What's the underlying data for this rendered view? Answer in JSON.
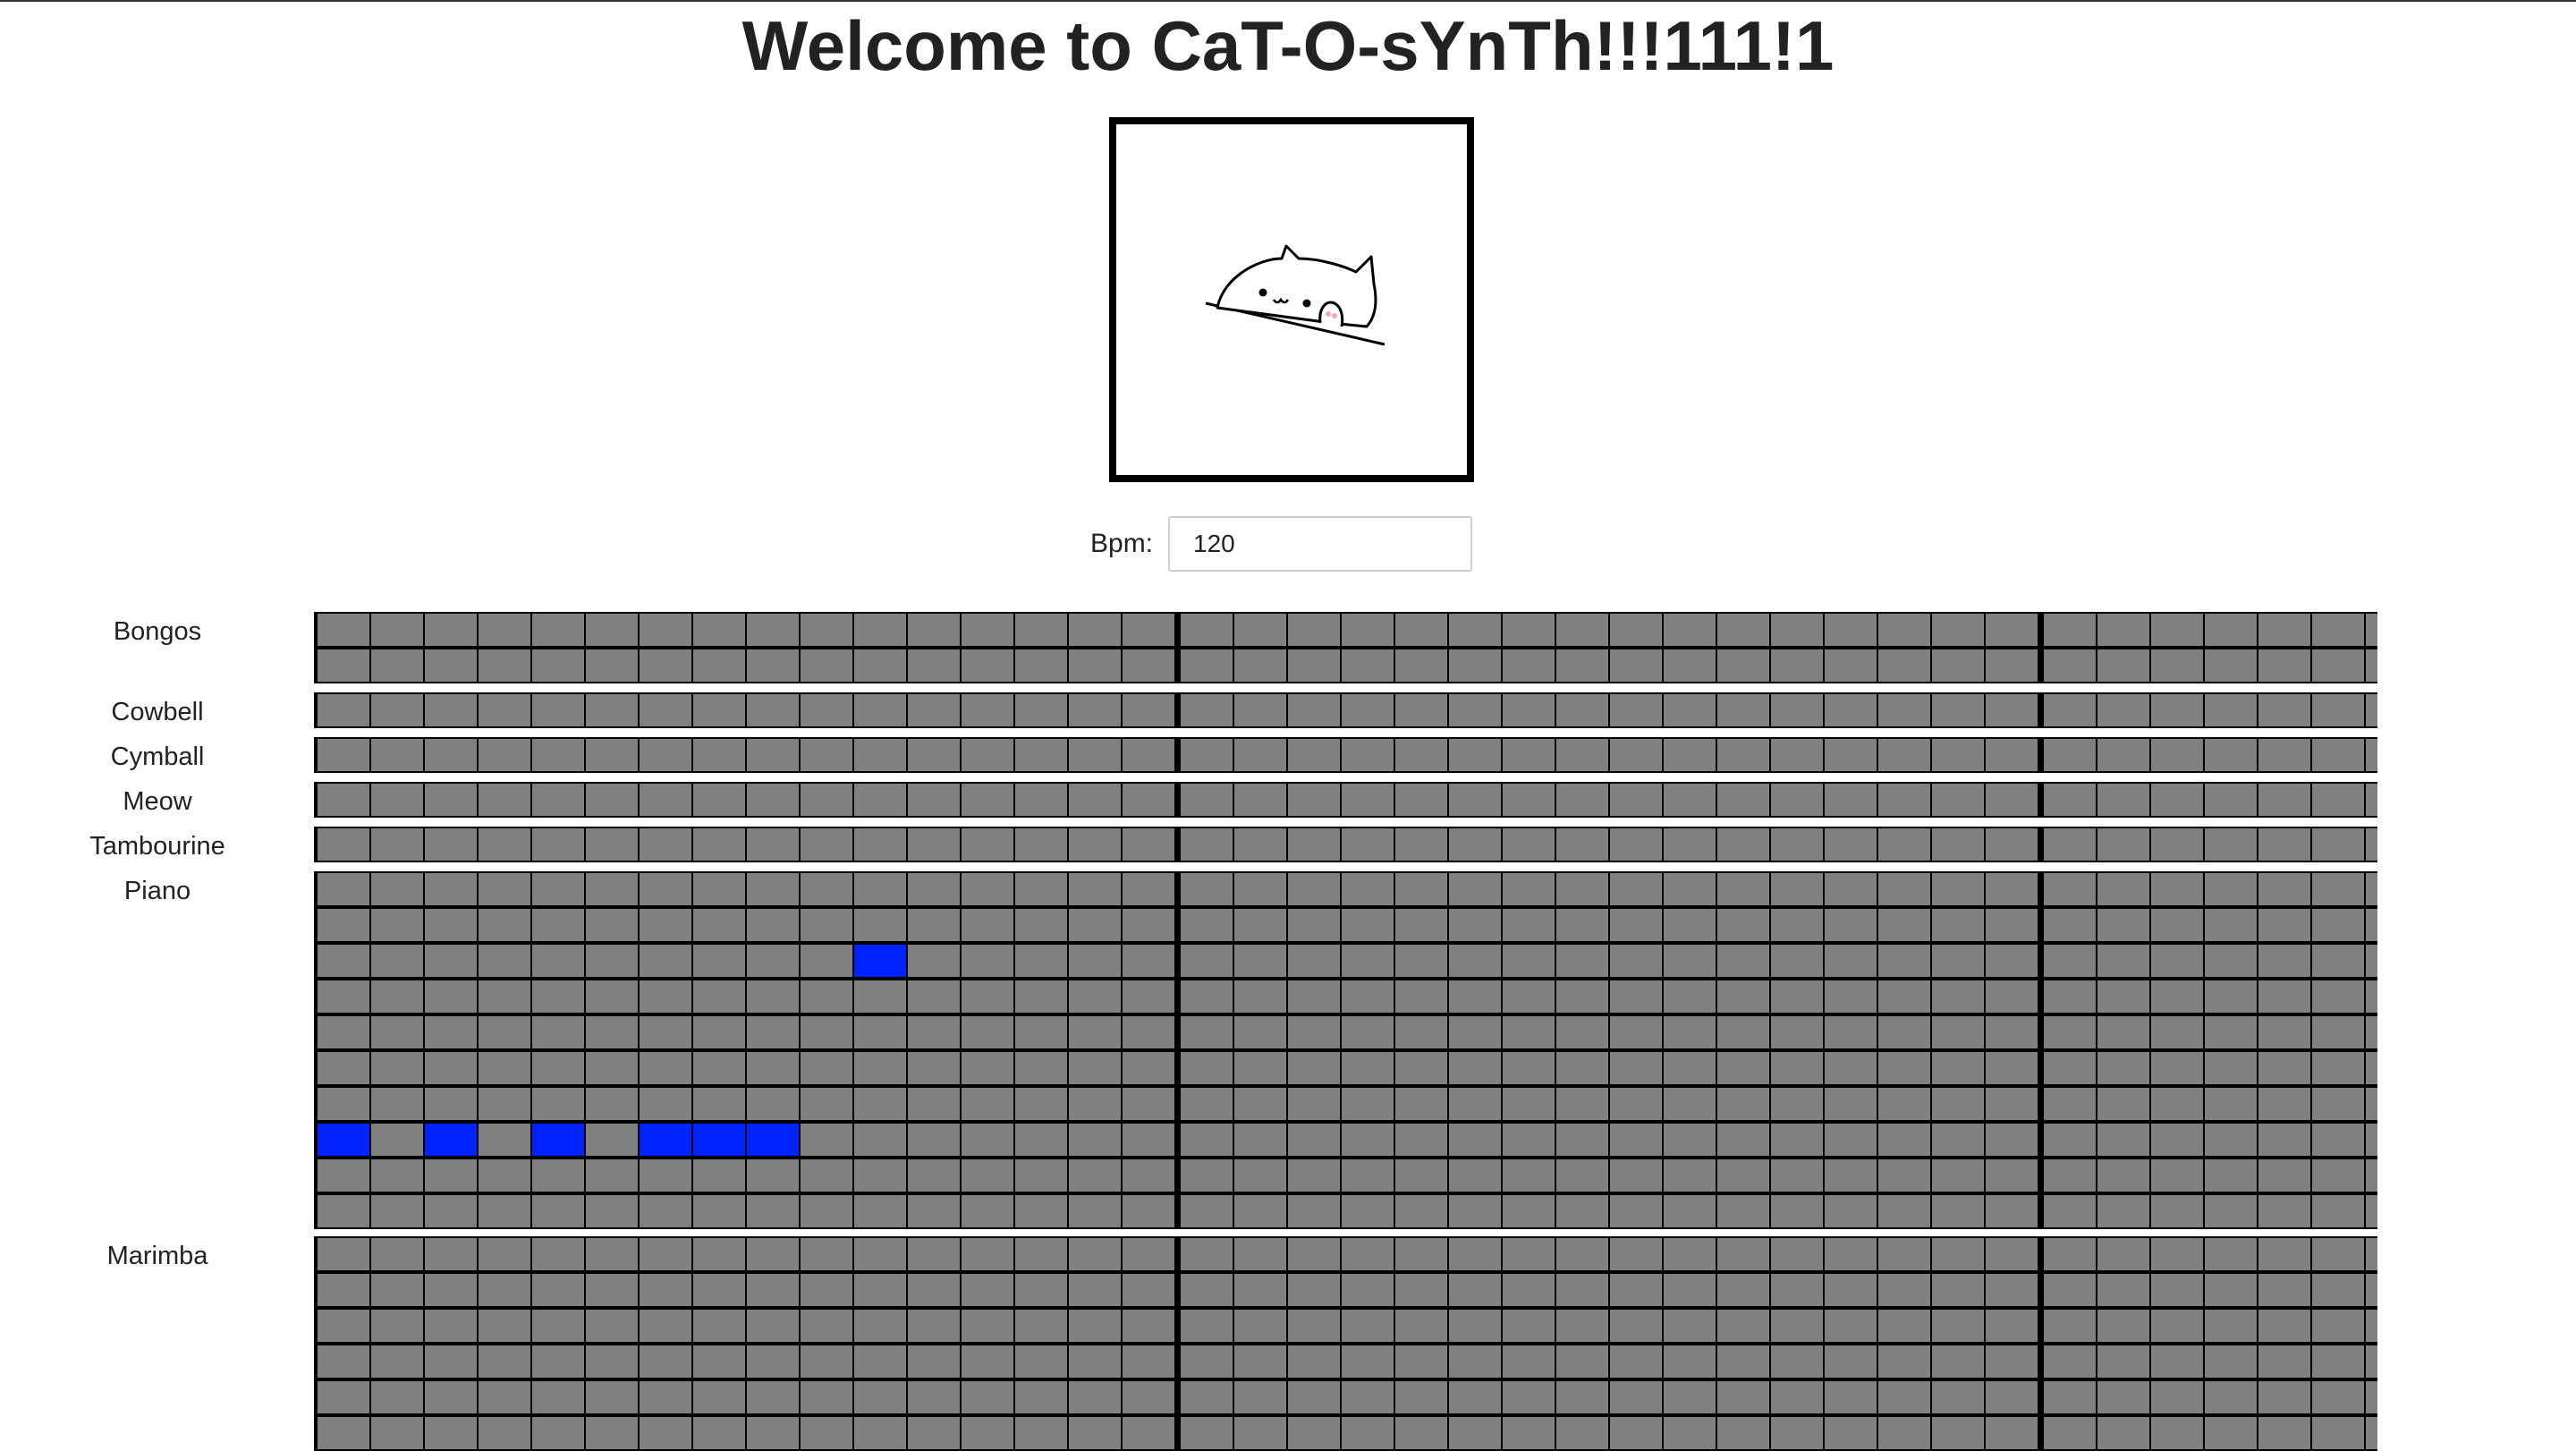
{
  "title": "Welcome to CaT-O-sYnTh!!!111!1",
  "cat_image": {
    "icon": "bongo-cat-icon"
  },
  "bpm": {
    "label": "Bpm:",
    "value": "120"
  },
  "colors": {
    "cell_off": "#808080",
    "cell_on": "#0022ff",
    "grid_line": "#000000"
  },
  "sequencer": {
    "steps_visible": 39,
    "beat_divider_every": 16,
    "instruments": [
      {
        "name": "Bongos",
        "rows": 2,
        "active": []
      },
      {
        "name": "Cowbell",
        "rows": 1,
        "active": []
      },
      {
        "name": "Cymball",
        "rows": 1,
        "active": []
      },
      {
        "name": "Meow",
        "rows": 1,
        "active": []
      },
      {
        "name": "Tambourine",
        "rows": 1,
        "active": []
      },
      {
        "name": "Piano",
        "rows": 10,
        "active": [
          [
            2,
            10
          ],
          [
            7,
            0
          ],
          [
            7,
            2
          ],
          [
            7,
            4
          ],
          [
            7,
            6
          ],
          [
            7,
            7
          ],
          [
            7,
            8
          ]
        ]
      },
      {
        "name": "Marimba",
        "rows": 6,
        "active": []
      }
    ]
  }
}
